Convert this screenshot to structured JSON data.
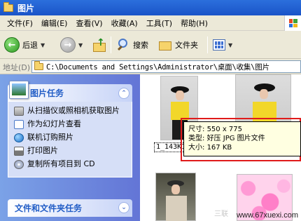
{
  "window": {
    "title": "图片"
  },
  "menu": [
    "文件(F)",
    "编辑(E)",
    "查看(V)",
    "收藏(A)",
    "工具(T)",
    "帮助(H)"
  ],
  "toolbar": {
    "back_label": "后退",
    "search_label": "搜索",
    "folders_label": "文件夹"
  },
  "address": {
    "label": "地址(D)",
    "path": "C:\\Documents and Settings\\Administrator\\桌面\\收集\\图片"
  },
  "tasks": {
    "picture_tasks_title": "图片任务",
    "items": [
      "从扫描仪或照相机获取图片",
      "作为幻灯片查看",
      "联机订购照片",
      "打印图片",
      "复制所有项目到 CD"
    ],
    "file_tasks_title": "文件和文件夹任务"
  },
  "files": {
    "rename_text": "1_143K1"
  },
  "tooltip": {
    "size_label": "尺寸:",
    "size_value": "550 x 775",
    "type_label": "类型:",
    "type_value": "好压 JPG 图片文件",
    "filesize_label": "大小:",
    "filesize_value": "167 KB"
  },
  "watermarks": {
    "site": "www.67xuexi.com",
    "brand": "三联"
  },
  "colors": {
    "highlight": "#e01b1b",
    "tooltip_bg": "#ffffe1",
    "sidebar": "#7ba2e7"
  }
}
